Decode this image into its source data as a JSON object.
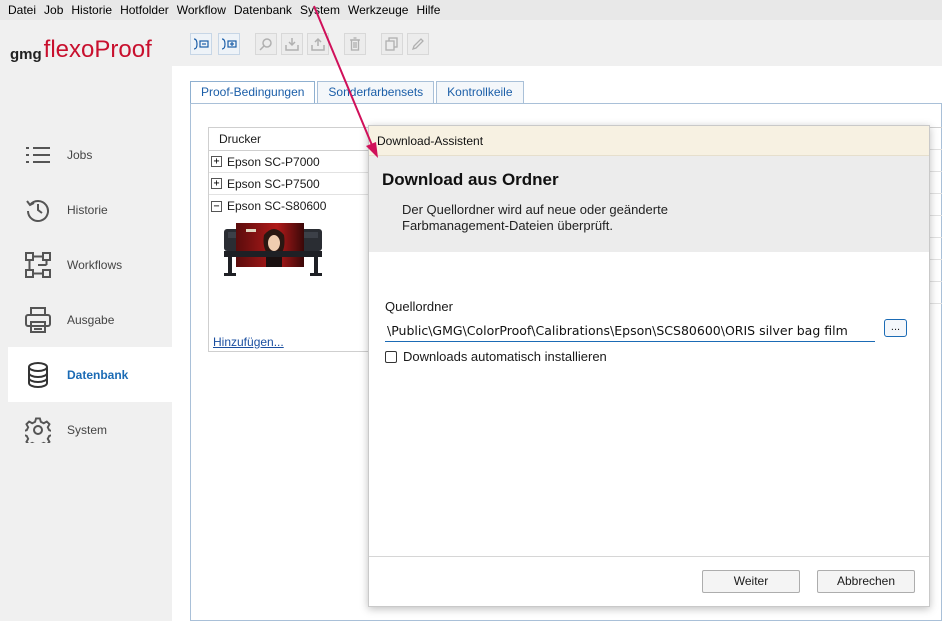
{
  "menubar": {
    "items": [
      "Datei",
      "Job",
      "Historie",
      "Hotfolder",
      "Workflow",
      "Datenbank",
      "System",
      "Werkzeuge",
      "Hilfe"
    ]
  },
  "logo": {
    "prefix": "gmg",
    "name": "flexoProof",
    "color": "#c8102e"
  },
  "sidebar": {
    "items": [
      {
        "label": "Jobs",
        "icon": "list-icon"
      },
      {
        "label": "Historie",
        "icon": "history-icon"
      },
      {
        "label": "Workflows",
        "icon": "workflow-icon"
      },
      {
        "label": "Ausgabe",
        "icon": "printer-icon"
      },
      {
        "label": "Datenbank",
        "icon": "database-icon",
        "active": true
      },
      {
        "label": "System",
        "icon": "gear-icon"
      }
    ],
    "active_color": "#1b6bb5"
  },
  "tabs": [
    {
      "label": "Proof-Bedingungen",
      "active": true
    },
    {
      "label": "Sonderfarbensets"
    },
    {
      "label": "Kontrollkeile"
    }
  ],
  "printers": {
    "header": "Drucker",
    "rows": [
      {
        "name": "Epson SC-P7000",
        "toggle": "+"
      },
      {
        "name": "Epson SC-P7500",
        "toggle": "+"
      },
      {
        "name": "Epson SC-S80600",
        "toggle": "−"
      }
    ],
    "add_link": "Hinzufügen..."
  },
  "dialog": {
    "title": "Download-Assistent",
    "heading": "Download aus Ordner",
    "description": "Der Quellordner wird auf neue oder geänderte Farbmanagement-Dateien überprüft.",
    "source_label": "Quellordner",
    "source_value": "\\Public\\GMG\\ColorProof\\Calibrations\\Epson\\SCS80600\\ORIS silver bag film",
    "browse_label": "...",
    "auto_install_label": "Downloads automatisch installieren",
    "auto_install_checked": false,
    "next_button": "Weiter",
    "cancel_button": "Abbrechen"
  },
  "annotation_color": "#d0105a"
}
